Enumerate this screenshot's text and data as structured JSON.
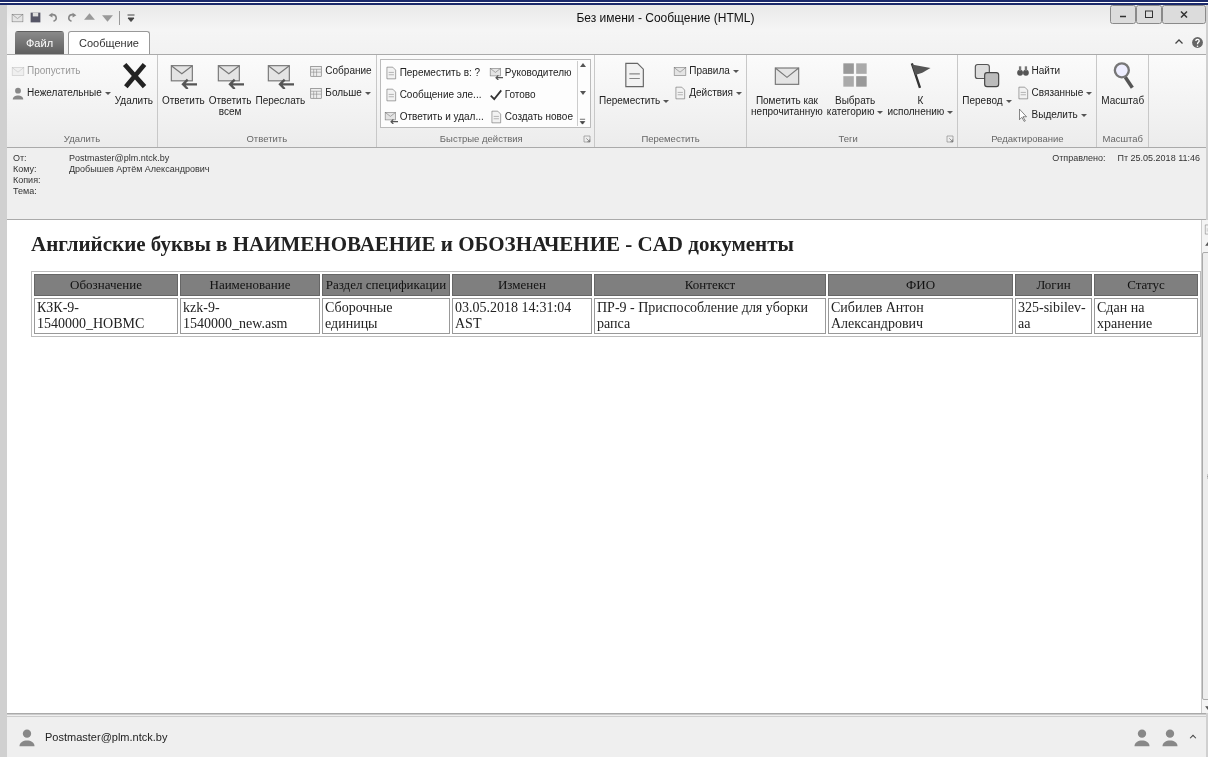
{
  "window": {
    "title": "Без имени  -  Сообщение (HTML)"
  },
  "tabs": [
    {
      "label": "Файл",
      "kind": "file",
      "selected": false
    },
    {
      "label": "Сообщение",
      "kind": "tab",
      "selected": true
    }
  ],
  "ribbon": {
    "groups": [
      {
        "label": "Удалить",
        "gallery": false,
        "launcher": false,
        "items": [
          {
            "label": "Пропустить",
            "kind": "small",
            "dropdown": false,
            "disabled": true
          },
          {
            "label": "Нежелательные",
            "kind": "small",
            "dropdown": true,
            "disabled": false
          },
          {
            "label": "Удалить",
            "kind": "large",
            "dropdown": false,
            "disabled": false
          }
        ]
      },
      {
        "label": "Ответить",
        "gallery": false,
        "launcher": false,
        "items": [
          {
            "label": "Ответить",
            "kind": "large",
            "dropdown": false,
            "disabled": false
          },
          {
            "label": "Ответить\nвсем",
            "kind": "large",
            "dropdown": false,
            "disabled": false
          },
          {
            "label": "Переслать",
            "kind": "large",
            "dropdown": false,
            "disabled": false
          },
          {
            "label": "Собрание",
            "kind": "small",
            "dropdown": false,
            "disabled": false
          },
          {
            "label": "Больше",
            "kind": "small",
            "dropdown": true,
            "disabled": false
          }
        ]
      },
      {
        "label": "Быстрые действия",
        "gallery": true,
        "launcher": true,
        "items": [
          {
            "label": "Переместить в: ?",
            "kind": "small",
            "dropdown": false,
            "disabled": false
          },
          {
            "label": "Сообщение эле...",
            "kind": "small",
            "dropdown": false,
            "disabled": false
          },
          {
            "label": "Ответить и удал...",
            "kind": "small",
            "dropdown": false,
            "disabled": false
          },
          {
            "label": "Руководителю",
            "kind": "small",
            "dropdown": false,
            "disabled": false
          },
          {
            "label": "Готово",
            "kind": "small",
            "dropdown": false,
            "disabled": false
          },
          {
            "label": "Создать новое",
            "kind": "small",
            "dropdown": false,
            "disabled": false
          }
        ]
      },
      {
        "label": "Переместить",
        "gallery": false,
        "launcher": false,
        "items": [
          {
            "label": "Переместить",
            "kind": "large",
            "dropdown": true,
            "disabled": false
          },
          {
            "label": "Правила",
            "kind": "small",
            "dropdown": true,
            "disabled": false
          },
          {
            "label": "Действия",
            "kind": "small",
            "dropdown": true,
            "disabled": false
          }
        ]
      },
      {
        "label": "Теги",
        "gallery": false,
        "launcher": true,
        "items": [
          {
            "label": "Пометить как\nнепрочитанную",
            "kind": "large",
            "dropdown": false,
            "disabled": false
          },
          {
            "label": "Выбрать\nкатегорию",
            "kind": "large",
            "dropdown": true,
            "disabled": false
          },
          {
            "label": "К\nисполнению",
            "kind": "large",
            "dropdown": true,
            "disabled": false
          }
        ]
      },
      {
        "label": "Редактирование",
        "gallery": false,
        "launcher": false,
        "items": [
          {
            "label": "Перевод",
            "kind": "large",
            "dropdown": true,
            "disabled": false
          },
          {
            "label": "Найти",
            "kind": "small",
            "dropdown": false,
            "disabled": false
          },
          {
            "label": "Связанные",
            "kind": "small",
            "dropdown": true,
            "disabled": false
          },
          {
            "label": "Выделить",
            "kind": "small",
            "dropdown": true,
            "disabled": false
          }
        ]
      },
      {
        "label": "Масштаб",
        "gallery": false,
        "launcher": false,
        "items": [
          {
            "label": "Масштаб",
            "kind": "large",
            "dropdown": false,
            "disabled": false
          }
        ]
      }
    ]
  },
  "header": {
    "fields": [
      {
        "label": "От:",
        "value": "Postmaster@plm.ntck.by"
      },
      {
        "label": "Кому:",
        "value": "Дробышев Артём Александрович"
      },
      {
        "label": "Копия:"
      },
      {
        "label": "Тема:"
      }
    ],
    "sent": {
      "label": "Отправлено:",
      "value": "Пт 25.05.2018 11:46"
    }
  },
  "body": {
    "heading": "Английские буквы в НАИМЕНОВАЕНИЕ и ОБОЗНАЧЕНИЕ - CAD документы",
    "table": {
      "columns": [
        "Обозначение",
        "Наименование",
        "Раздел спецификации",
        "Изменен",
        "Контекст",
        "ФИО",
        "Логин",
        "Статус"
      ],
      "rows": [
        [
          "КЗК-9-1540000_НОВМС",
          "kzk-9-1540000_new.asm",
          "Сборочные единицы",
          "03.05.2018 14:31:04 AST",
          "ПР-9 - Приспособление для уборки рапса",
          "Сибилев Антон Александрович",
          "325-sibilev-aa",
          "Сдан на хранение"
        ]
      ]
    }
  },
  "people_pane": {
    "name": "Postmaster@plm.ntck.by"
  }
}
